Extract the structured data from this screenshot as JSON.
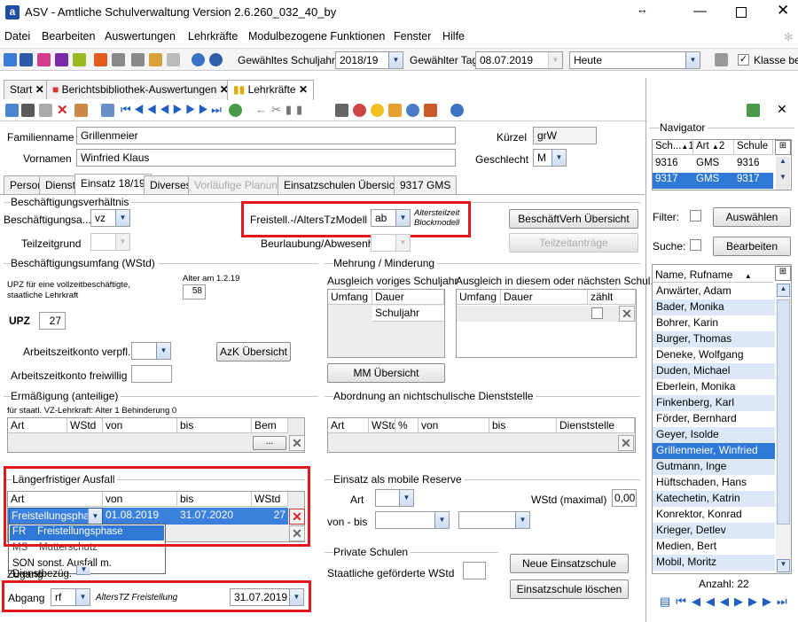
{
  "window": {
    "title": "ASV - Amtliche Schulverwaltung Version 2.6.260_032_40_by"
  },
  "menu": [
    "Datei",
    "Bearbeiten",
    "Auswertungen",
    "Lehrkräfte",
    "Modulbezogene Funktionen",
    "Fenster",
    "Hilfe"
  ],
  "toolbar": {
    "schuljahr_label": "Gewähltes Schuljahr",
    "schuljahr_value": "2018/19",
    "tag_label": "Gewählter Tag",
    "tag_value": "08.07.2019",
    "heute_value": "Heute",
    "klasse_label": "Klasse beib"
  },
  "doc_tabs": [
    "Start",
    "Berichtsbibliothek-Auswertungen",
    "Lehrkräfte"
  ],
  "form": {
    "familienname_label": "Familienname",
    "familienname": "Grillenmeier",
    "vornamen_label": "Vornamen",
    "vornamen": "Winfried Klaus",
    "kuerzel_label": "Kürzel",
    "kuerzel": "grW",
    "geschlecht_label": "Geschlecht",
    "geschlecht": "M"
  },
  "tabs": [
    "Person",
    "Dienst",
    "Einsatz 18/19",
    "Diverses",
    "Vorläufige Planung",
    "Einsatzschulen Übersicht",
    "9317 GMS"
  ],
  "beschaeftigung": {
    "section": "Beschäftigungsverhältnis",
    "art_label": "Beschäftigungsa...",
    "art_value": "vz",
    "teilzeitgrund_label": "Teilzeitgrund",
    "freistell_label": "Freistell.-/AltersTzModell",
    "freistell_value": "ab",
    "freistell_note1": "Altersteilzeit",
    "freistell_note2": "Blockmodell",
    "beurlaubung_label": "Beurlaubung/Abwesenheit",
    "btn_uebersicht": "BeschäftVerh Übersicht",
    "btn_teilzeit": "Teilzeitanträge"
  },
  "umfang": {
    "section": "Beschäftigungsumfang (WStd)",
    "upz_note1": "UPZ für eine vollzeitbeschäftigte,",
    "upz_note2": "staatliche Lehrkraft",
    "alter_label": "Alter am 1.2.19",
    "alter_value": "58",
    "upz_label": "UPZ",
    "upz_value": "27",
    "azk_verpfl": "Arbeitszeitkonto verpfl.",
    "azk_frei": "Arbeitszeitkonto freiwillig",
    "btn_azk": "AzK Übersicht"
  },
  "mehrung": {
    "section": "Mehrung / Minderung",
    "left_title": "Ausgleich voriges Schuljahr",
    "right_title": "Ausgleich in diesem oder nächsten Schul...",
    "col_umfang": "Umfang",
    "col_dauer": "Dauer",
    "col_zaehlt": "zählt",
    "row_dauer": "Schuljahr",
    "btn_mm": "MM Übersicht"
  },
  "ermaessigung": {
    "section": "Ermäßigung (anteilige)",
    "note": "für staatl. VZ-Lehrkraft: Alter 1 Behinderung 0",
    "cols": [
      "Art",
      "WStd",
      "von",
      "bis",
      "Bem"
    ],
    "dots": "..."
  },
  "abordnung": {
    "section": "Abordnung an nichtschulische Dienststelle",
    "cols": [
      "Art",
      "WStd",
      "%",
      "von",
      "bis",
      "Dienststelle"
    ]
  },
  "ausfall": {
    "section": "Längerfristiger Ausfall",
    "cols": [
      "Art",
      "von",
      "bis",
      "WStd"
    ],
    "row_art": "Freistellungsphas",
    "row_von": "01.08.2019",
    "row_bis": "31.07.2020",
    "row_wstd": "27",
    "dropdown": [
      {
        "code": "FR",
        "label": "Freistellungsphase"
      },
      {
        "code": "MS",
        "label": "Mutterschutz"
      },
      {
        "code": "SON",
        "label": "sonst. Ausfall m. Dienstbezüg."
      }
    ]
  },
  "zugang_label": "Zugang",
  "abgang": {
    "label": "Abgang",
    "value": "rf",
    "note": "AltersTZ Freistellung",
    "date": "31.07.2019"
  },
  "mobile": {
    "section": "Einsatz als mobile Reserve",
    "art_label": "Art",
    "wstd_label": "WStd (maximal)",
    "wstd_value": "0,00",
    "vonbis_label": "von - bis"
  },
  "privat": {
    "section": "Private Schulen",
    "label": "Staatliche geförderte WStd",
    "btn_neu": "Neue Einsatzschule",
    "btn_loeschen": "Einsatzschule löschen"
  },
  "navigator": {
    "title": "Navigator",
    "cols": [
      "Sch...",
      "Art",
      "Schule"
    ],
    "sort1": "1",
    "sort2": "2",
    "rows": [
      {
        "sch": "9316",
        "art": "GMS",
        "schule": "9316"
      },
      {
        "sch": "9317",
        "art": "GMS",
        "schule": "9317"
      }
    ],
    "filter_label": "Filter:",
    "btn_auswaehlen": "Auswählen",
    "suche_label": "Suche:",
    "btn_bearbeiten": "Bearbeiten",
    "list_header": "Name, Rufname",
    "names": [
      "Anwärter, Adam",
      "Bader, Monika",
      "Bohrer, Karin",
      "Burger, Thomas",
      "Deneke, Wolfgang",
      "Duden, Michael",
      "Eberlein, Monika",
      "Finkenberg, Karl",
      "Förder, Bernhard",
      "Geyer, Isolde",
      "Grillenmeier, Winfried",
      "Gutmann, Inge",
      "Hüftschaden, Hans",
      "Katechetin, Katrin",
      "Konrektor, Konrad",
      "Krieger, Detlev",
      "Medien, Bert",
      "Mobil, Moritz"
    ],
    "selected_index": 10,
    "anzahl": "Anzahl: 22"
  }
}
